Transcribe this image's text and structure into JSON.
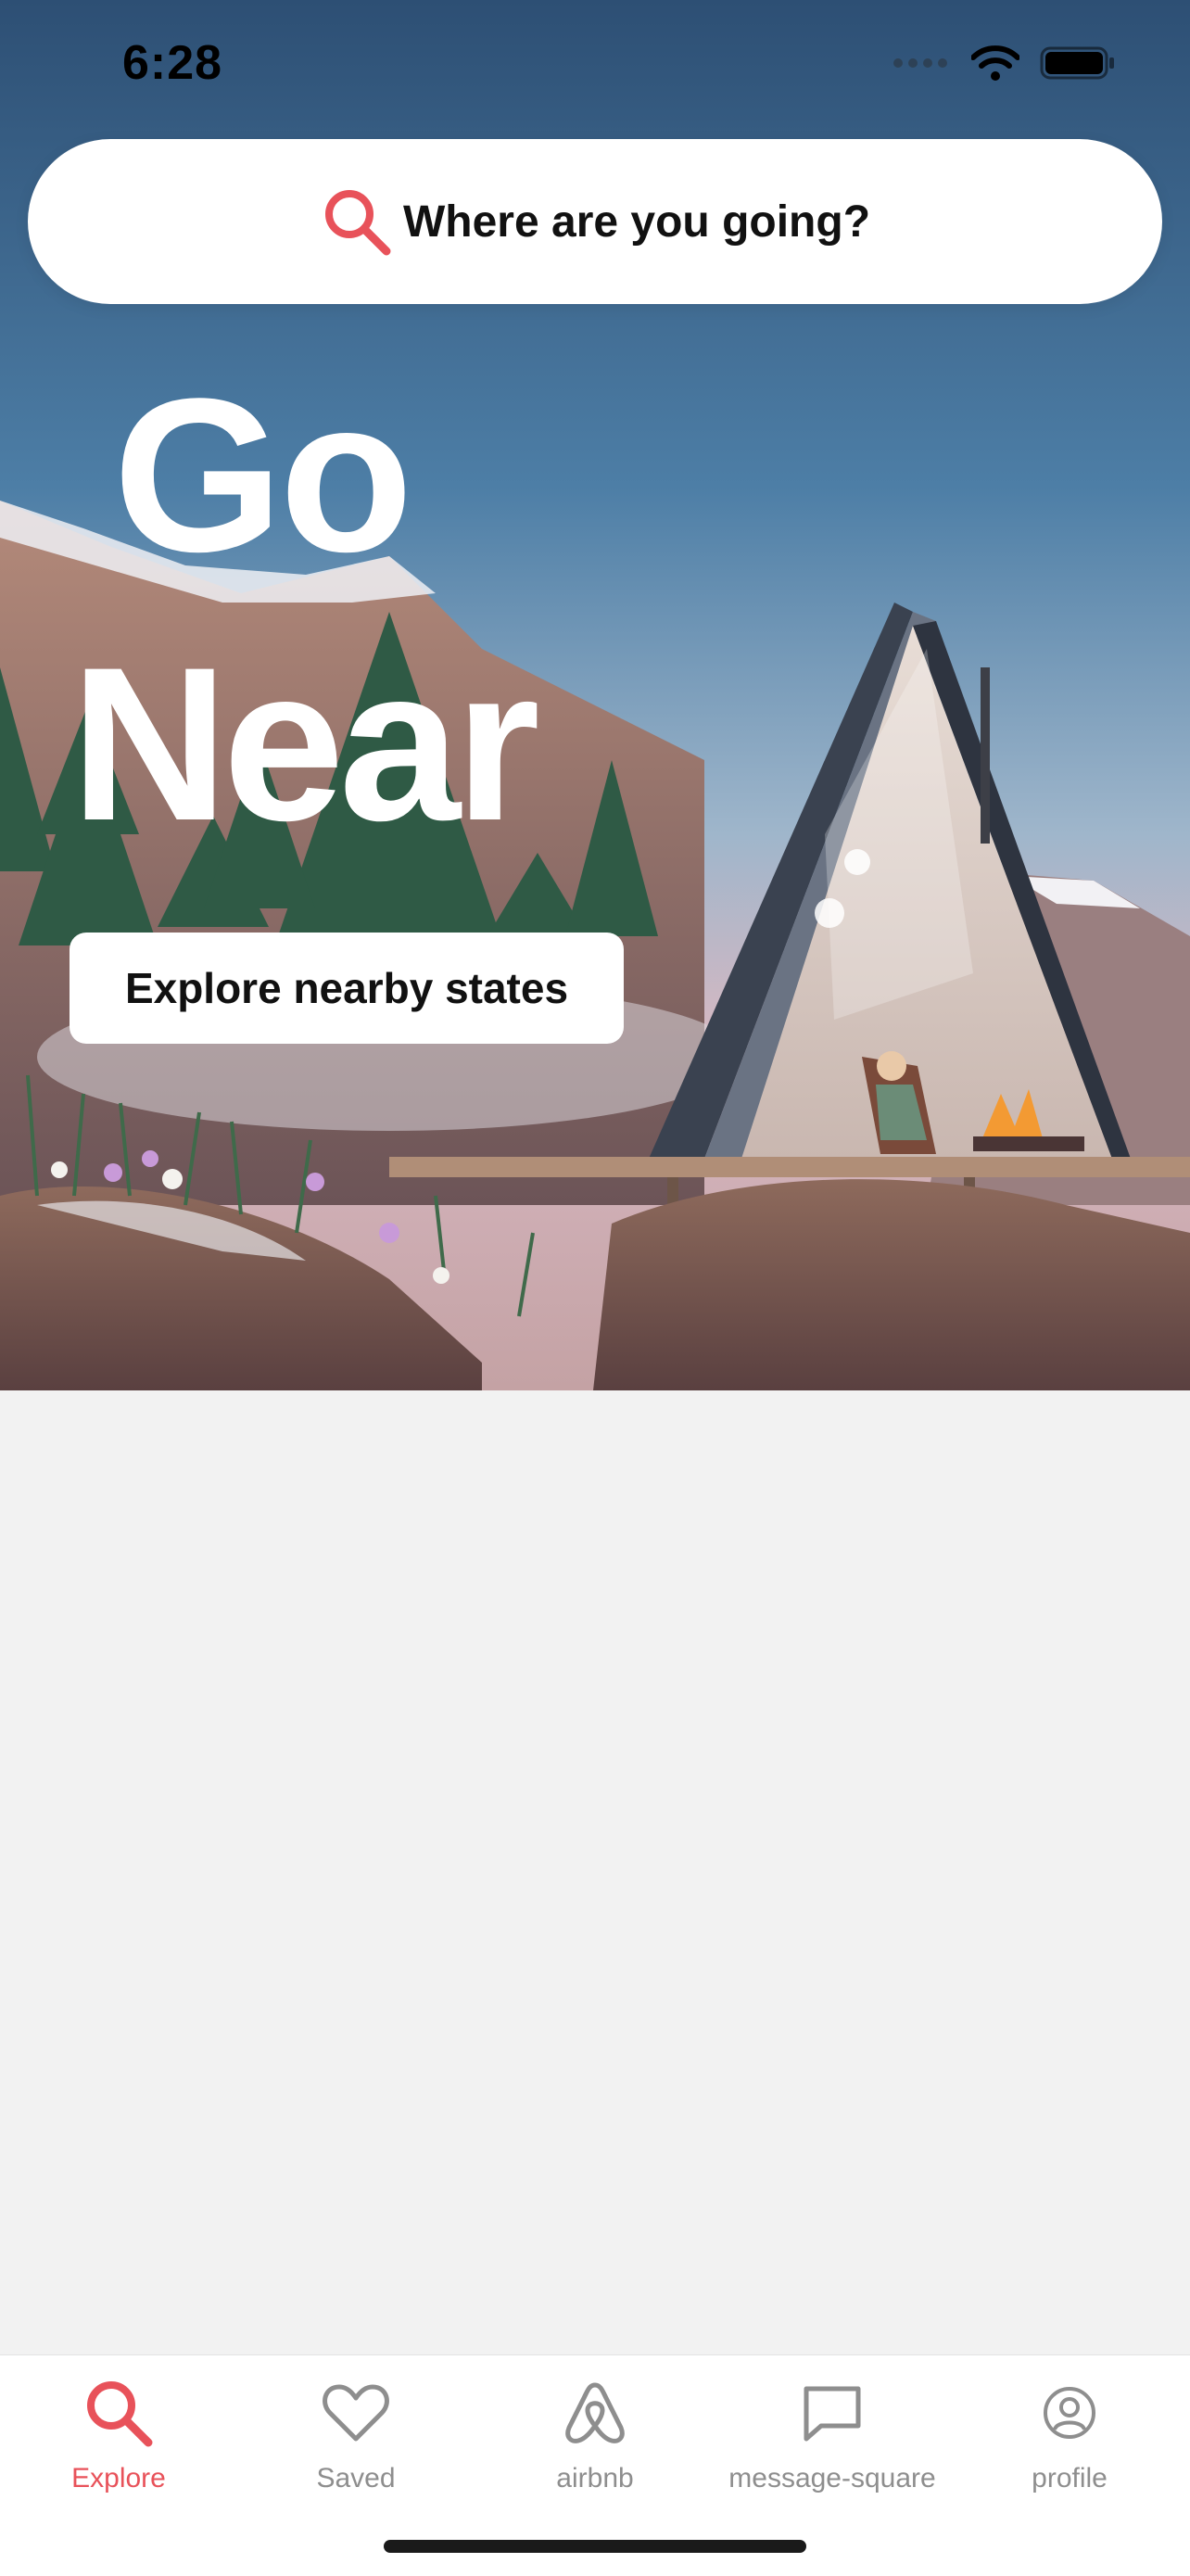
{
  "status_bar": {
    "time": "6:28"
  },
  "search": {
    "label": "Where are you going?"
  },
  "hero": {
    "line1": "Go",
    "line2": "Near",
    "button_label": "Explore nearby states"
  },
  "tabs": [
    {
      "label": "Explore",
      "icon": "search-icon",
      "active": true
    },
    {
      "label": "Saved",
      "icon": "heart-icon",
      "active": false
    },
    {
      "label": "airbnb",
      "icon": "airbnb-logo-icon",
      "active": false
    },
    {
      "label": "message-square",
      "icon": "message-square-icon",
      "active": false
    },
    {
      "label": "profile",
      "icon": "profile-icon",
      "active": false
    }
  ],
  "colors": {
    "accent": "#e8525a",
    "inactive": "#8e8e8e",
    "background": "#f2f2f2"
  }
}
